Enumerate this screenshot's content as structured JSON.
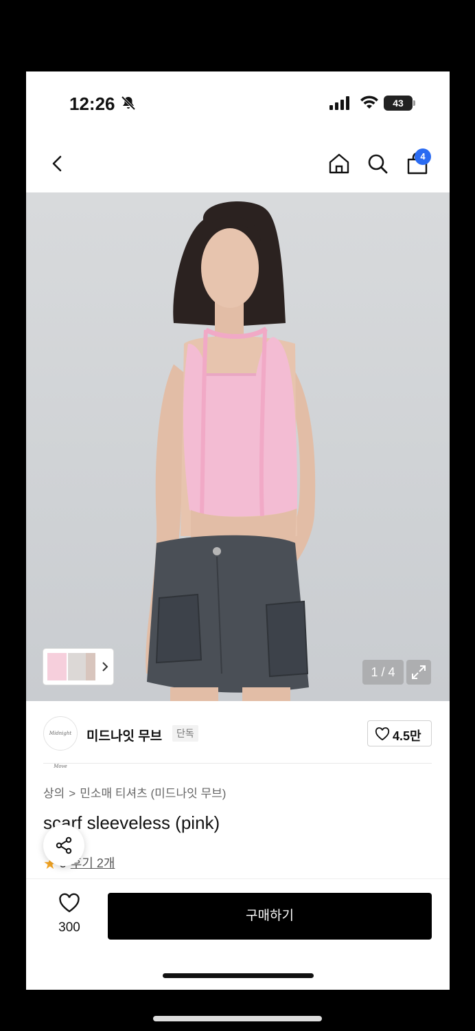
{
  "status_bar": {
    "time": "12:26",
    "battery": "43"
  },
  "nav": {
    "cart_count": "4"
  },
  "gallery": {
    "counter": "1 / 4"
  },
  "brand": {
    "logo_text": "Midnight Move",
    "name": "미드나잇 무브",
    "tag": "단독",
    "likes": "4.5만"
  },
  "breadcrumb": {
    "category": "상의",
    "separator": ">",
    "subcategory": "민소매 티셔츠 (미드나잇 무브)"
  },
  "product": {
    "title": "scarf sleeveless (pink)",
    "rating": "5",
    "reviews": "후기 2개"
  },
  "bottom_bar": {
    "like_count": "300",
    "buy_label": "구매하기"
  },
  "colors": {
    "accent": "#2a6bf2",
    "star": "#f5a623",
    "buy_button": "#000000",
    "top_color": "#f3bcd3",
    "skirt_color": "#4a4f56"
  }
}
